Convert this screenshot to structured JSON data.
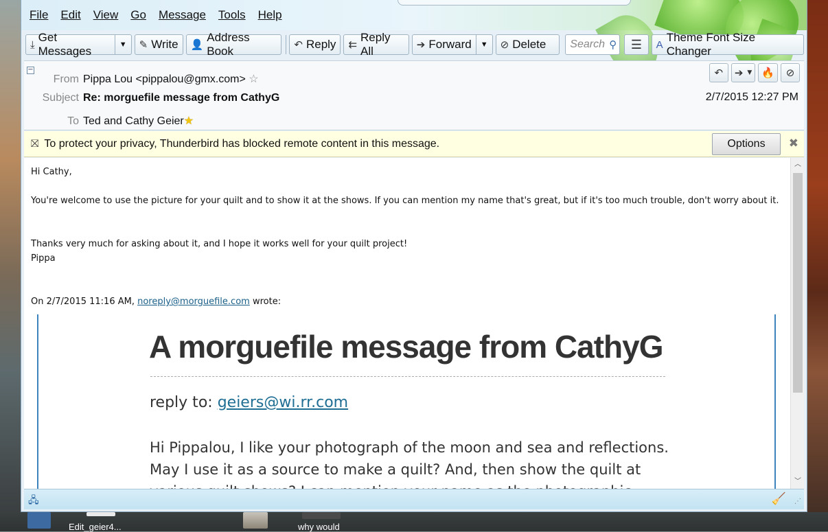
{
  "menu": {
    "items": [
      {
        "label": "File"
      },
      {
        "label": "Edit"
      },
      {
        "label": "View"
      },
      {
        "label": "Go"
      },
      {
        "label": "Message"
      },
      {
        "label": "Tools"
      },
      {
        "label": "Help"
      }
    ]
  },
  "toolbar": {
    "get_messages": "Get Messages",
    "write": "Write",
    "address_book": "Address Book",
    "reply": "Reply",
    "reply_all": "Reply All",
    "forward": "Forward",
    "delete": "Delete",
    "search_placeholder": "Search",
    "theme_font": "Theme Font Size Changer"
  },
  "header": {
    "from_label": "From",
    "from_value": "Pippa Lou <pippalou@gmx.com>",
    "subject_label": "Subject",
    "subject_value": "Re: morguefile message from CathyG",
    "to_label": "To",
    "to_value": "Ted and Cathy Geier",
    "date": "2/7/2015 12:27 PM"
  },
  "notice": {
    "text": "To protect your privacy, Thunderbird has blocked remote content in this message.",
    "options_label": "Options"
  },
  "body": {
    "greeting": "Hi Cathy,",
    "paragraph1": "You're welcome to use the picture for your quilt and to show it at the shows.  If you can mention my name that's great, but if it's too much trouble, don't worry about it.",
    "paragraph2_line1": "Thanks very much for asking about it, and I hope it works well for your quilt project!",
    "signature": "Pippa",
    "quote_intro_prefix": "On 2/7/2015 11:16 AM, ",
    "quote_intro_link": "noreply@morguefile.com",
    "quote_intro_suffix": " wrote:",
    "quote_title": "A morguefile message from CathyG",
    "quote_reply_prefix": "reply to: ",
    "quote_reply_link": "geiers@wi.rr.com",
    "quote_text": "Hi Pippalou, I like your photograph of the moon and sea and reflections. May I use it as a source to make a quilt? And, then show the quilt at various quilt shows? I can mention your name as the photographic source."
  },
  "taskbar": {
    "item1": "Edit_geier4...",
    "item2": "why would"
  },
  "icons": {
    "get_messages": "download-icon",
    "write": "pencil-icon",
    "address_book": "contact-icon",
    "reply": "reply-icon",
    "reply_all": "reply-all-icon",
    "forward": "forward-icon",
    "delete": "delete-icon",
    "search": "magnifier-icon",
    "menu": "hamburger-icon",
    "theme": "theme-icon"
  }
}
